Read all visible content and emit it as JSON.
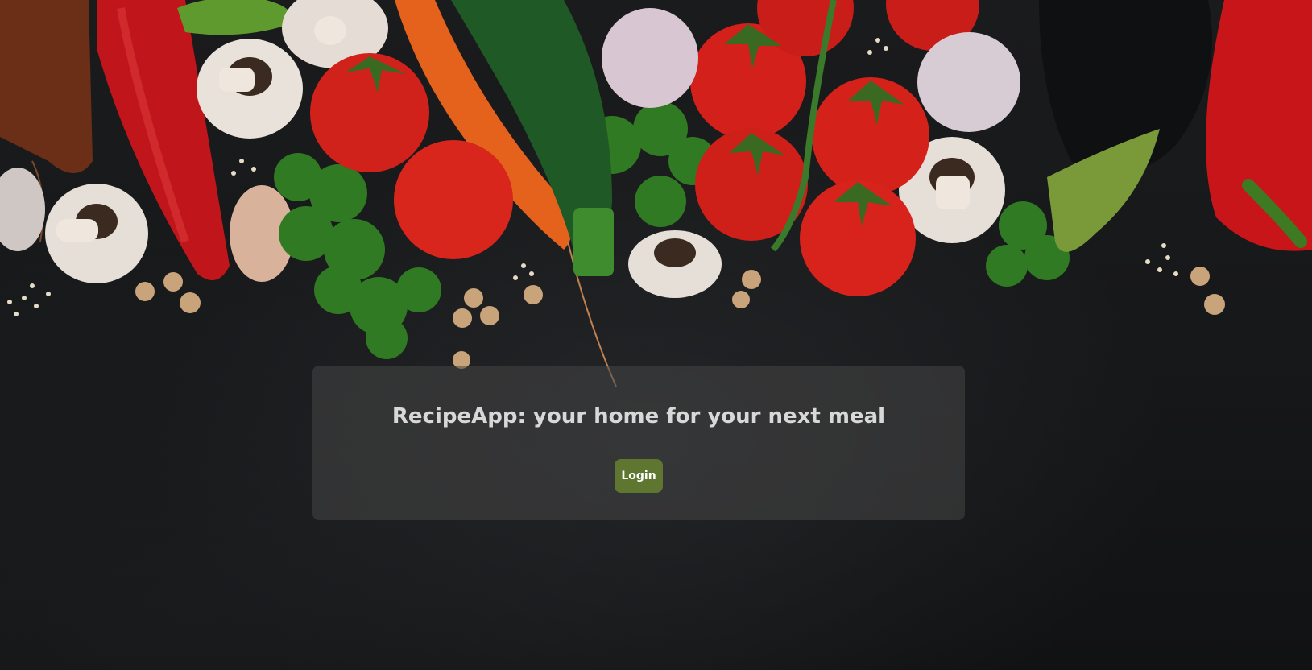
{
  "hero": {
    "background_image": "vegetables-on-dark-slate",
    "title": "RecipeApp: your home for your next meal",
    "login_label": "Login"
  },
  "colors": {
    "card_overlay": "#464646",
    "login_button": "#5f7630",
    "title_text": "#d8d8d8"
  }
}
